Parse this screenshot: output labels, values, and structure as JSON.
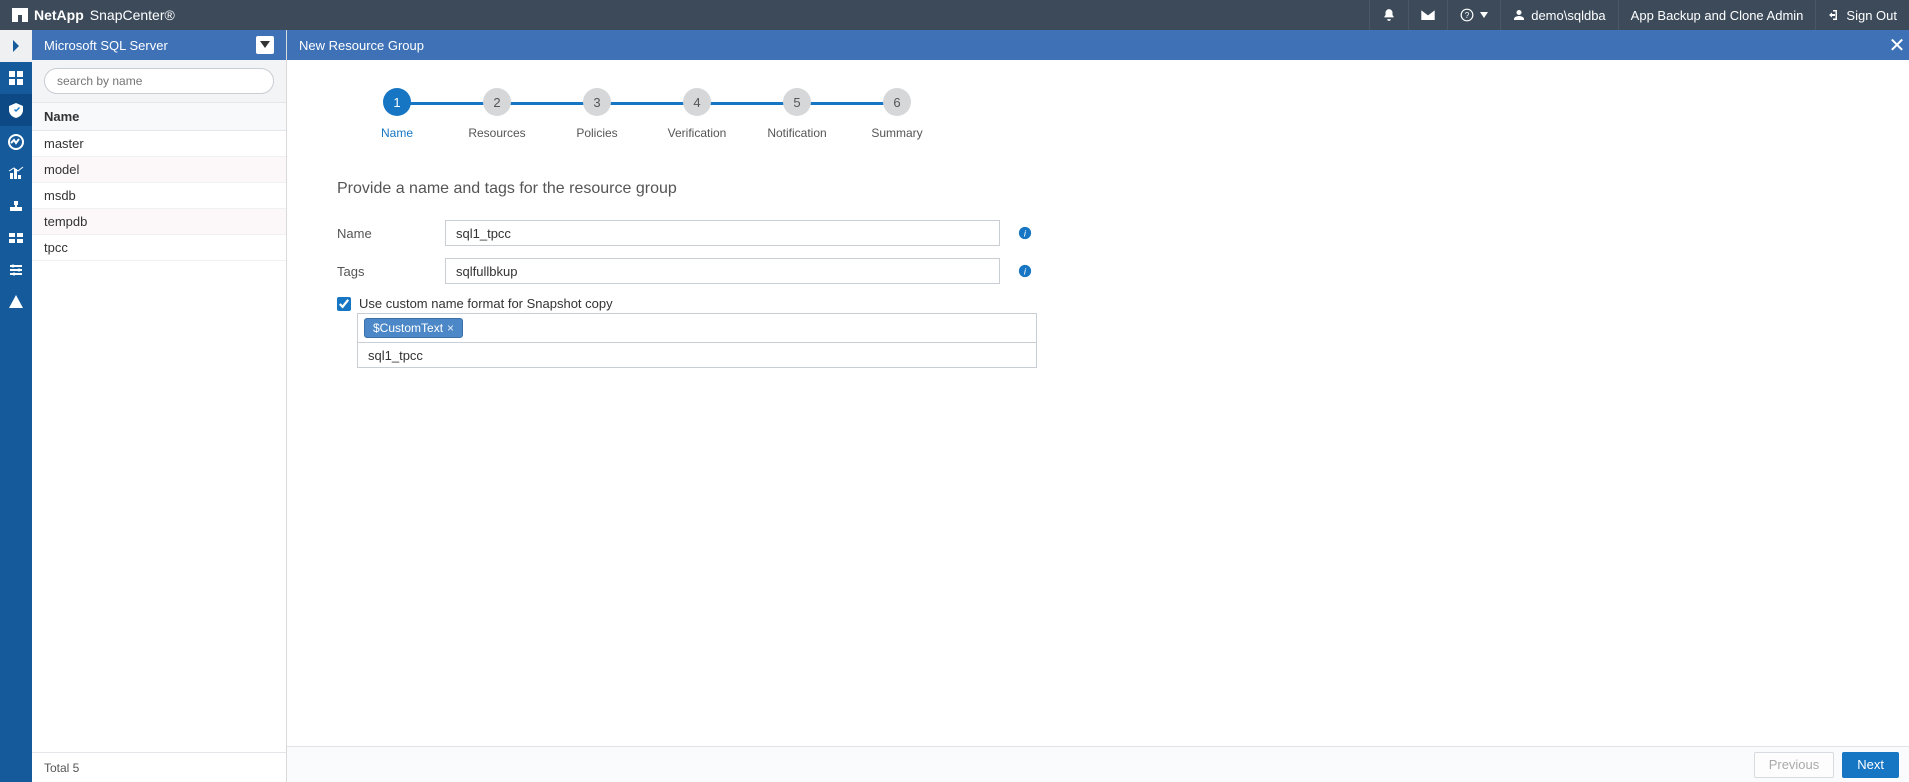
{
  "brand": {
    "company": "NetApp",
    "product": "SnapCenter®"
  },
  "topbar": {
    "user": "demo\\sqldba",
    "role": "App Backup and Clone Admin",
    "signout": "Sign Out"
  },
  "listpanel": {
    "selector_label": "Microsoft SQL Server",
    "search_placeholder": "search by name",
    "column_header": "Name",
    "rows": [
      "master",
      "model",
      "msdb",
      "tempdb",
      "tpcc"
    ],
    "total_label": "Total 5"
  },
  "content_header": {
    "title": "New Resource Group"
  },
  "stepper": {
    "steps": [
      {
        "num": "1",
        "label": "Name"
      },
      {
        "num": "2",
        "label": "Resources"
      },
      {
        "num": "3",
        "label": "Policies"
      },
      {
        "num": "4",
        "label": "Verification"
      },
      {
        "num": "5",
        "label": "Notification"
      },
      {
        "num": "6",
        "label": "Summary"
      }
    ]
  },
  "form": {
    "title": "Provide a name and tags for the resource group",
    "name_label": "Name",
    "name_value": "sql1_tpcc",
    "tags_label": "Tags",
    "tags_value": "sqlfullbkup",
    "custom_fmt_label": "Use custom name format for Snapshot copy",
    "custom_fmt_checked": true,
    "token_value": "$CustomText",
    "custom_name_value": "sql1_tpcc"
  },
  "actions": {
    "prev": "Previous",
    "next": "Next"
  }
}
